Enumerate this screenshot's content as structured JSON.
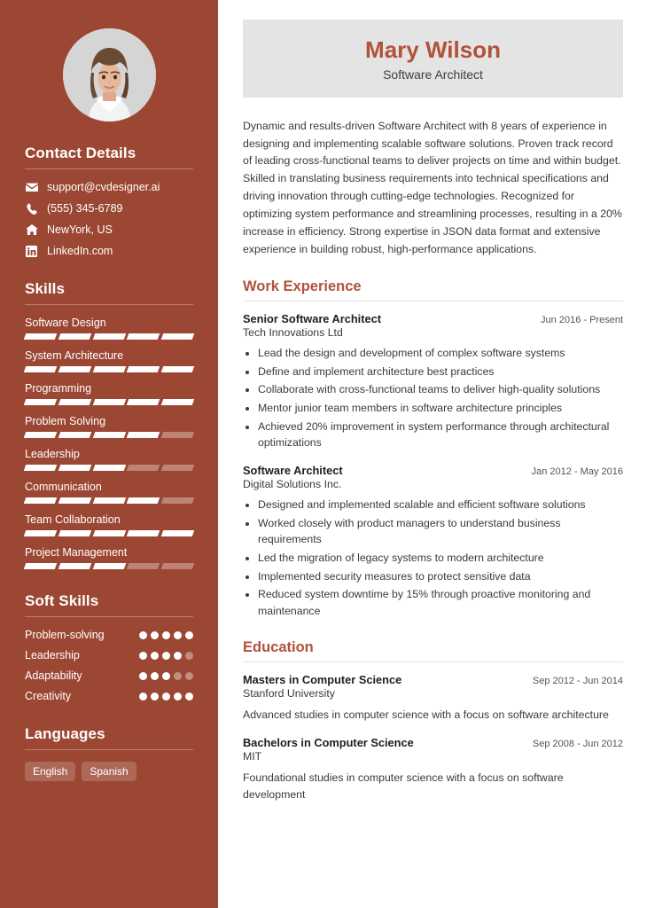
{
  "colors": {
    "sidebar_bg": "#9c4733",
    "accent": "#b1523a",
    "name_card_bg": "#e4e4e4",
    "body_text": "#3a3a3a"
  },
  "header": {
    "name": "Mary Wilson",
    "job_title": "Software Architect"
  },
  "summary": "Dynamic and results-driven Software Architect with 8 years of experience in designing and implementing scalable software solutions. Proven track record of leading cross-functional teams to deliver projects on time and within budget. Skilled in translating business requirements into technical specifications and driving innovation through cutting-edge technologies. Recognized for optimizing system performance and streamlining processes, resulting in a 20% increase in efficiency. Strong expertise in JSON data format and extensive experience in building robust, high-performance applications.",
  "sidebar": {
    "contact": {
      "heading": "Contact Details",
      "items": [
        {
          "icon": "envelope-icon",
          "value": "support@cvdesigner.ai"
        },
        {
          "icon": "phone-icon",
          "value": "(555) 345-6789"
        },
        {
          "icon": "home-icon",
          "value": "NewYork, US"
        },
        {
          "icon": "linkedin-icon",
          "value": "LinkedIn.com"
        }
      ]
    },
    "skills": {
      "heading": "Skills",
      "max_level": 5,
      "items": [
        {
          "name": "Software Design",
          "level": 5
        },
        {
          "name": "System Architecture",
          "level": 5
        },
        {
          "name": "Programming",
          "level": 5
        },
        {
          "name": "Problem Solving",
          "level": 4
        },
        {
          "name": "Leadership",
          "level": 3
        },
        {
          "name": "Communication",
          "level": 4
        },
        {
          "name": "Team Collaboration",
          "level": 5
        },
        {
          "name": "Project Management",
          "level": 3
        }
      ]
    },
    "soft_skills": {
      "heading": "Soft Skills",
      "max_level": 5,
      "items": [
        {
          "name": "Problem-solving",
          "level": 5
        },
        {
          "name": "Leadership",
          "level": 4
        },
        {
          "name": "Adaptability",
          "level": 3
        },
        {
          "name": "Creativity",
          "level": 5
        }
      ]
    },
    "languages": {
      "heading": "Languages",
      "items": [
        "English",
        "Spanish"
      ]
    }
  },
  "work_experience": {
    "heading": "Work Experience",
    "entries": [
      {
        "role": "Senior Software Architect",
        "date": "Jun 2016 - Present",
        "org": "Tech Innovations Ltd",
        "bullets": [
          "Lead the design and development of complex software systems",
          "Define and implement architecture best practices",
          "Collaborate with cross-functional teams to deliver high-quality solutions",
          "Mentor junior team members in software architecture principles",
          "Achieved 20% improvement in system performance through architectural optimizations"
        ]
      },
      {
        "role": "Software Architect",
        "date": "Jan 2012 - May 2016",
        "org": "Digital Solutions Inc.",
        "bullets": [
          "Designed and implemented scalable and efficient software solutions",
          "Worked closely with product managers to understand business requirements",
          "Led the migration of legacy systems to modern architecture",
          "Implemented security measures to protect sensitive data",
          "Reduced system downtime by 15% through proactive monitoring and maintenance"
        ]
      }
    ]
  },
  "education": {
    "heading": "Education",
    "entries": [
      {
        "degree": "Masters in Computer Science",
        "date": "Sep 2012 - Jun 2014",
        "school": "Stanford University",
        "description": "Advanced studies in computer science with a focus on software architecture"
      },
      {
        "degree": "Bachelors in Computer Science",
        "date": "Sep 2008 - Jun 2012",
        "school": "MIT",
        "description": "Foundational studies in computer science with a focus on software development"
      }
    ]
  }
}
